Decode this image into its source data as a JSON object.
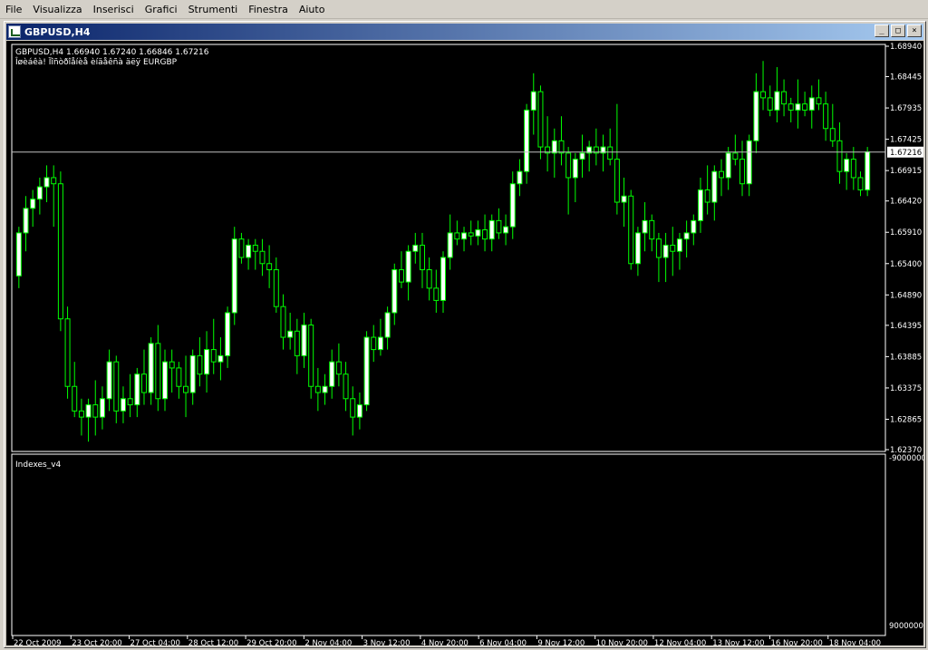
{
  "menu": [
    "File",
    "Visualizza",
    "Inserisci",
    "Grafici",
    "Strumenti",
    "Finestra",
    "Aiuto"
  ],
  "window": {
    "title": "GBPUSD,H4",
    "buttons": {
      "minimize": "_",
      "restore": "□",
      "close": "×"
    }
  },
  "chart_data": {
    "type": "candlestick",
    "header_line1": "GBPUSD,H4  1.66940 1.67240 1.66846 1.67216",
    "header_line2": "Îøèáêà! Ïîñòðîåíèå èíäåêñà äëÿ EURGBP",
    "indicator_label": "Indexes_v4",
    "current_price": "1.67216",
    "price_ticks": [
      "1.68940",
      "1.68445",
      "1.67935",
      "1.67425",
      "1.66915",
      "1.66420",
      "1.65910",
      "1.65400",
      "1.64890",
      "1.64395",
      "1.63885",
      "1.63375",
      "1.62865",
      "1.62370"
    ],
    "indicator_ticks": [
      "-9000000",
      "9000000"
    ],
    "time_ticks": [
      "22 Oct 2009",
      "23 Oct 20:00",
      "27 Oct 04:00",
      "28 Oct 12:00",
      "29 Oct 20:00",
      "2 Nov 04:00",
      "3 Nov 12:00",
      "4 Nov 20:00",
      "6 Nov 04:00",
      "9 Nov 12:00",
      "10 Nov 20:00",
      "12 Nov 04:00",
      "13 Nov 12:00",
      "16 Nov 20:00",
      "18 Nov 04:00"
    ],
    "ylim": [
      1.6237,
      1.6894
    ],
    "candles": [
      [
        1.652,
        1.66,
        1.65,
        1.659
      ],
      [
        1.659,
        1.665,
        1.656,
        1.663
      ],
      [
        1.663,
        1.666,
        1.66,
        1.6645
      ],
      [
        1.6645,
        1.668,
        1.662,
        1.6665
      ],
      [
        1.6665,
        1.67,
        1.664,
        1.668
      ],
      [
        1.668,
        1.67,
        1.66,
        1.667
      ],
      [
        1.667,
        1.669,
        1.643,
        1.645
      ],
      [
        1.645,
        1.647,
        1.632,
        1.634
      ],
      [
        1.634,
        1.638,
        1.629,
        1.63
      ],
      [
        1.63,
        1.632,
        1.626,
        1.629
      ],
      [
        1.629,
        1.632,
        1.625,
        1.631
      ],
      [
        1.631,
        1.635,
        1.626,
        1.629
      ],
      [
        1.629,
        1.634,
        1.627,
        1.632
      ],
      [
        1.632,
        1.64,
        1.63,
        1.638
      ],
      [
        1.638,
        1.639,
        1.628,
        1.63
      ],
      [
        1.63,
        1.634,
        1.628,
        1.632
      ],
      [
        1.632,
        1.636,
        1.629,
        1.631
      ],
      [
        1.631,
        1.637,
        1.629,
        1.636
      ],
      [
        1.636,
        1.64,
        1.631,
        1.633
      ],
      [
        1.633,
        1.642,
        1.631,
        1.641
      ],
      [
        1.641,
        1.644,
        1.63,
        1.632
      ],
      [
        1.632,
        1.64,
        1.63,
        1.638
      ],
      [
        1.638,
        1.64,
        1.633,
        1.637
      ],
      [
        1.637,
        1.638,
        1.632,
        1.634
      ],
      [
        1.634,
        1.639,
        1.629,
        1.633
      ],
      [
        1.633,
        1.64,
        1.631,
        1.639
      ],
      [
        1.639,
        1.642,
        1.634,
        1.636
      ],
      [
        1.636,
        1.643,
        1.633,
        1.64
      ],
      [
        1.64,
        1.645,
        1.636,
        1.638
      ],
      [
        1.638,
        1.642,
        1.635,
        1.639
      ],
      [
        1.639,
        1.647,
        1.637,
        1.646
      ],
      [
        1.646,
        1.66,
        1.644,
        1.658
      ],
      [
        1.658,
        1.659,
        1.654,
        1.655
      ],
      [
        1.655,
        1.658,
        1.653,
        1.657
      ],
      [
        1.657,
        1.658,
        1.653,
        1.656
      ],
      [
        1.656,
        1.658,
        1.652,
        1.654
      ],
      [
        1.654,
        1.657,
        1.65,
        1.653
      ],
      [
        1.653,
        1.655,
        1.646,
        1.647
      ],
      [
        1.647,
        1.649,
        1.64,
        1.642
      ],
      [
        1.642,
        1.646,
        1.64,
        1.643
      ],
      [
        1.643,
        1.645,
        1.636,
        1.639
      ],
      [
        1.639,
        1.646,
        1.637,
        1.644
      ],
      [
        1.644,
        1.645,
        1.632,
        1.634
      ],
      [
        1.634,
        1.637,
        1.63,
        1.633
      ],
      [
        1.633,
        1.636,
        1.631,
        1.634
      ],
      [
        1.634,
        1.64,
        1.632,
        1.638
      ],
      [
        1.638,
        1.641,
        1.634,
        1.636
      ],
      [
        1.636,
        1.638,
        1.63,
        1.632
      ],
      [
        1.632,
        1.634,
        1.626,
        1.629
      ],
      [
        1.629,
        1.633,
        1.627,
        1.631
      ],
      [
        1.631,
        1.643,
        1.63,
        1.642
      ],
      [
        1.642,
        1.644,
        1.638,
        1.64
      ],
      [
        1.64,
        1.645,
        1.639,
        1.642
      ],
      [
        1.642,
        1.647,
        1.64,
        1.646
      ],
      [
        1.646,
        1.654,
        1.644,
        1.653
      ],
      [
        1.653,
        1.656,
        1.65,
        1.651
      ],
      [
        1.651,
        1.657,
        1.648,
        1.656
      ],
      [
        1.656,
        1.659,
        1.654,
        1.657
      ],
      [
        1.657,
        1.659,
        1.65,
        1.653
      ],
      [
        1.653,
        1.655,
        1.648,
        1.65
      ],
      [
        1.65,
        1.653,
        1.646,
        1.648
      ],
      [
        1.648,
        1.656,
        1.646,
        1.655
      ],
      [
        1.655,
        1.662,
        1.653,
        1.659
      ],
      [
        1.659,
        1.661,
        1.657,
        1.658
      ],
      [
        1.658,
        1.66,
        1.656,
        1.659
      ],
      [
        1.659,
        1.661,
        1.657,
        1.6585
      ],
      [
        1.6585,
        1.661,
        1.657,
        1.6595
      ],
      [
        1.6595,
        1.662,
        1.656,
        1.658
      ],
      [
        1.658,
        1.662,
        1.656,
        1.661
      ],
      [
        1.661,
        1.663,
        1.658,
        1.659
      ],
      [
        1.659,
        1.662,
        1.657,
        1.66
      ],
      [
        1.66,
        1.669,
        1.658,
        1.667
      ],
      [
        1.667,
        1.671,
        1.665,
        1.669
      ],
      [
        1.669,
        1.68,
        1.667,
        1.679
      ],
      [
        1.679,
        1.685,
        1.675,
        1.682
      ],
      [
        1.682,
        1.683,
        1.671,
        1.673
      ],
      [
        1.673,
        1.678,
        1.669,
        1.672
      ],
      [
        1.672,
        1.676,
        1.668,
        1.674
      ],
      [
        1.674,
        1.678,
        1.67,
        1.672
      ],
      [
        1.672,
        1.673,
        1.662,
        1.668
      ],
      [
        1.668,
        1.672,
        1.664,
        1.671
      ],
      [
        1.671,
        1.675,
        1.668,
        1.672
      ],
      [
        1.672,
        1.674,
        1.669,
        1.673
      ],
      [
        1.673,
        1.676,
        1.67,
        1.672
      ],
      [
        1.672,
        1.675,
        1.669,
        1.673
      ],
      [
        1.673,
        1.676,
        1.67,
        1.671
      ],
      [
        1.671,
        1.68,
        1.662,
        1.664
      ],
      [
        1.664,
        1.668,
        1.66,
        1.665
      ],
      [
        1.665,
        1.666,
        1.653,
        1.654
      ],
      [
        1.654,
        1.66,
        1.652,
        1.659
      ],
      [
        1.659,
        1.664,
        1.656,
        1.661
      ],
      [
        1.661,
        1.662,
        1.656,
        1.658
      ],
      [
        1.658,
        1.659,
        1.651,
        1.655
      ],
      [
        1.655,
        1.659,
        1.651,
        1.657
      ],
      [
        1.657,
        1.66,
        1.652,
        1.656
      ],
      [
        1.656,
        1.659,
        1.653,
        1.658
      ],
      [
        1.658,
        1.661,
        1.655,
        1.659
      ],
      [
        1.659,
        1.662,
        1.657,
        1.661
      ],
      [
        1.661,
        1.668,
        1.659,
        1.666
      ],
      [
        1.666,
        1.67,
        1.662,
        1.664
      ],
      [
        1.664,
        1.67,
        1.661,
        1.669
      ],
      [
        1.669,
        1.671,
        1.665,
        1.668
      ],
      [
        1.668,
        1.673,
        1.666,
        1.672
      ],
      [
        1.672,
        1.675,
        1.67,
        1.671
      ],
      [
        1.671,
        1.674,
        1.665,
        1.667
      ],
      [
        1.667,
        1.675,
        1.665,
        1.674
      ],
      [
        1.674,
        1.685,
        1.672,
        1.682
      ],
      [
        1.682,
        1.687,
        1.679,
        1.681
      ],
      [
        1.681,
        1.683,
        1.678,
        1.679
      ],
      [
        1.679,
        1.686,
        1.677,
        1.682
      ],
      [
        1.682,
        1.684,
        1.678,
        1.68
      ],
      [
        1.68,
        1.681,
        1.677,
        1.679
      ],
      [
        1.679,
        1.684,
        1.676,
        1.68
      ],
      [
        1.68,
        1.682,
        1.678,
        1.679
      ],
      [
        1.679,
        1.683,
        1.676,
        1.681
      ],
      [
        1.681,
        1.684,
        1.679,
        1.68
      ],
      [
        1.68,
        1.682,
        1.674,
        1.676
      ],
      [
        1.676,
        1.68,
        1.673,
        1.674
      ],
      [
        1.674,
        1.677,
        1.667,
        1.669
      ],
      [
        1.669,
        1.672,
        1.666,
        1.671
      ],
      [
        1.671,
        1.673,
        1.666,
        1.668
      ],
      [
        1.668,
        1.669,
        1.665,
        1.666
      ],
      [
        1.666,
        1.673,
        1.665,
        1.6722
      ]
    ]
  },
  "colors": {
    "background": "#000000",
    "candle": "#00ff00",
    "bull_body": "#ffffff",
    "bear_body": "#000000",
    "grid_text": "#ffffff",
    "price_line": "#c0c0c0"
  }
}
